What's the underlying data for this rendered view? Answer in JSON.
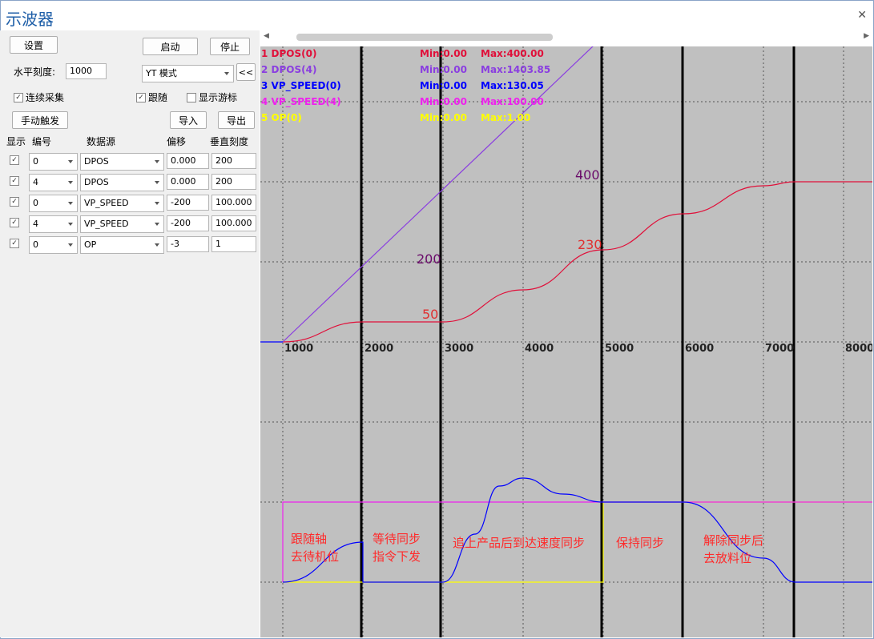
{
  "window": {
    "title": "示波器",
    "close_icon": "close-icon"
  },
  "toolbar": {
    "settings": "设置",
    "start": "启动",
    "stop": "停止",
    "hscale_label": "水平刻度:",
    "hscale_value": "1000",
    "mode_value": "YT 模式",
    "collapse": "<<",
    "continuous": "连续采集",
    "follow": "跟随",
    "cursor": "显示游标",
    "manual_trigger": "手动触发",
    "import": "导入",
    "export": "导出"
  },
  "table": {
    "headers": [
      "显示",
      "编号",
      "数据源",
      "偏移",
      "垂直刻度"
    ],
    "rows": [
      {
        "id": "0",
        "source": "DPOS",
        "offset": "0.000",
        "vscale": "200"
      },
      {
        "id": "4",
        "source": "DPOS",
        "offset": "0.000",
        "vscale": "200"
      },
      {
        "id": "0",
        "source": "VP_SPEED",
        "offset": "-200",
        "vscale": "100.000"
      },
      {
        "id": "4",
        "source": "VP_SPEED",
        "offset": "-200",
        "vscale": "100.000"
      },
      {
        "id": "0",
        "source": "OP",
        "offset": "-3",
        "vscale": "1"
      }
    ]
  },
  "legend": [
    {
      "name": "1 DPOS(0)",
      "min": "Min:0.00",
      "max": "Max:400.00",
      "color": "#e0103a"
    },
    {
      "name": "2 DPOS(4)",
      "min": "Min:0.00",
      "max": "Max:1403.85",
      "color": "#8a3ee0"
    },
    {
      "name": "3 VP_SPEED(0)",
      "min": "Min:0.00",
      "max": "Max:130.05",
      "color": "#0000ff"
    },
    {
      "name": "4 VP_SPEED(4)",
      "min": "Min:0.00",
      "max": "Max:100.00",
      "color": "#ee22ee"
    },
    {
      "name": "5 OP(0)",
      "min": "Min:0.00",
      "max": "Max:1.00",
      "color": "#ffff00"
    }
  ],
  "chart_data": {
    "type": "line",
    "xticks": [
      "1000",
      "2000",
      "3000",
      "4000",
      "5000",
      "6000",
      "7000",
      "8000"
    ],
    "xlim": [
      720,
      8360
    ],
    "point_labels": [
      "400",
      "200",
      "230",
      "50"
    ],
    "phase_labels": [
      [
        "跟随轴",
        "去待机位"
      ],
      [
        "等待同步",
        "指令下发"
      ],
      [
        "追上产品后到达速度同步"
      ],
      [
        "保持同步"
      ],
      [
        "解除同步后",
        "去放料位"
      ]
    ],
    "phase_dividers_x": [
      1980,
      2970,
      4980,
      5990,
      7380
    ],
    "dpos4": {
      "x": [
        1000,
        8360
      ],
      "y": [
        0,
        1403.85
      ]
    },
    "dpos0": {
      "x": [
        1000,
        2000,
        3000,
        4000,
        5000,
        6000,
        7000,
        7400,
        8360
      ],
      "y": [
        0,
        50,
        50,
        130,
        230,
        320,
        390,
        400,
        400
      ]
    },
    "vp_speed0": {
      "x": [
        1000,
        2000,
        2000,
        3000,
        3400,
        3700,
        4000,
        4500,
        5000,
        6000,
        7000,
        7400,
        8360
      ],
      "y": [
        0,
        50,
        0,
        0,
        60,
        120,
        130,
        110,
        100,
        100,
        30,
        0,
        0
      ]
    },
    "vp_speed4": {
      "x": [
        1000,
        1000,
        1010,
        8360
      ],
      "y": [
        0,
        100,
        100,
        100
      ]
    },
    "op0": {
      "x": [
        1000,
        5000,
        5000,
        7400,
        8360
      ],
      "y": [
        0,
        0,
        1,
        1,
        1
      ]
    }
  }
}
